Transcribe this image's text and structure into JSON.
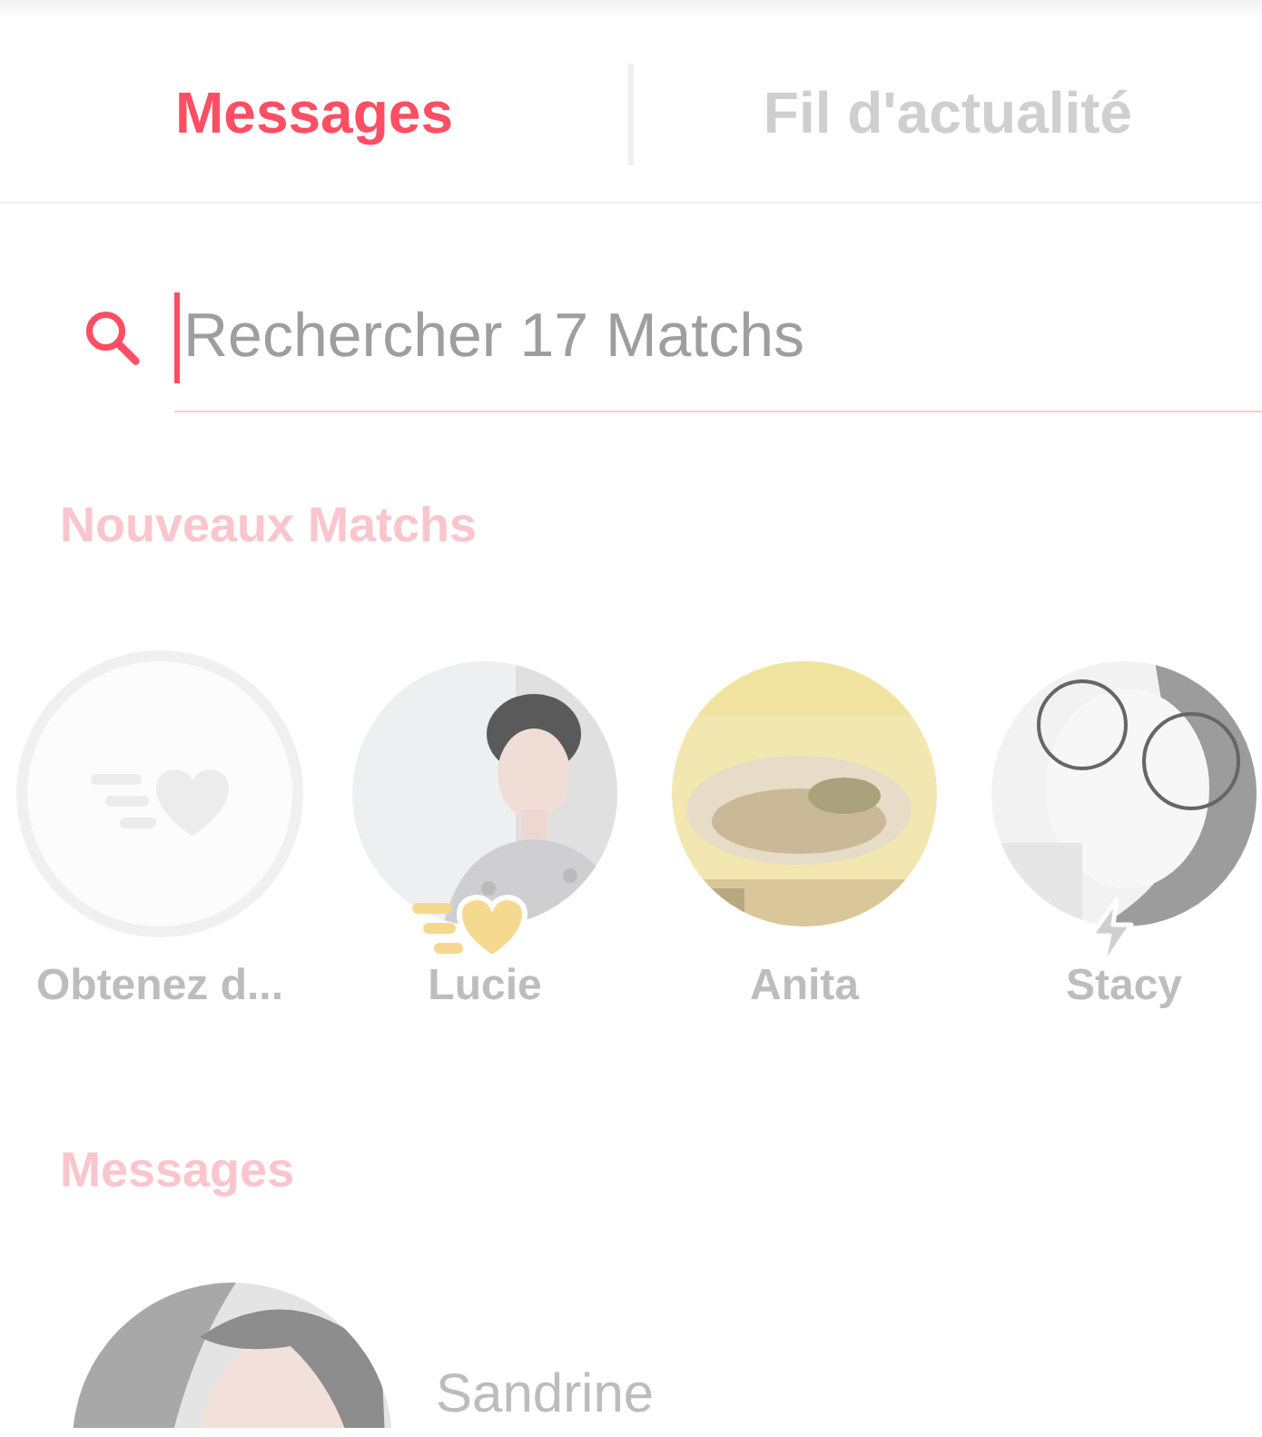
{
  "tabs": [
    {
      "label": "Messages",
      "selected": true
    },
    {
      "label": "Fil d'actualité",
      "selected": false
    }
  ],
  "search": {
    "placeholder": "Rechercher 17 Matchs"
  },
  "new_matches": {
    "heading": "Nouveaux Matchs",
    "items": [
      {
        "kind": "promo",
        "name": "Obtenez d..."
      },
      {
        "kind": "person",
        "name": "Lucie",
        "badge": {
          "kind": "boost"
        }
      },
      {
        "kind": "person",
        "name": "Anita"
      },
      {
        "kind": "person",
        "name": "Stacy",
        "badge": {
          "kind": "lightning"
        }
      }
    ]
  },
  "messages": {
    "heading": "Messages",
    "items": [
      {
        "name": "Sandrine"
      }
    ]
  }
}
